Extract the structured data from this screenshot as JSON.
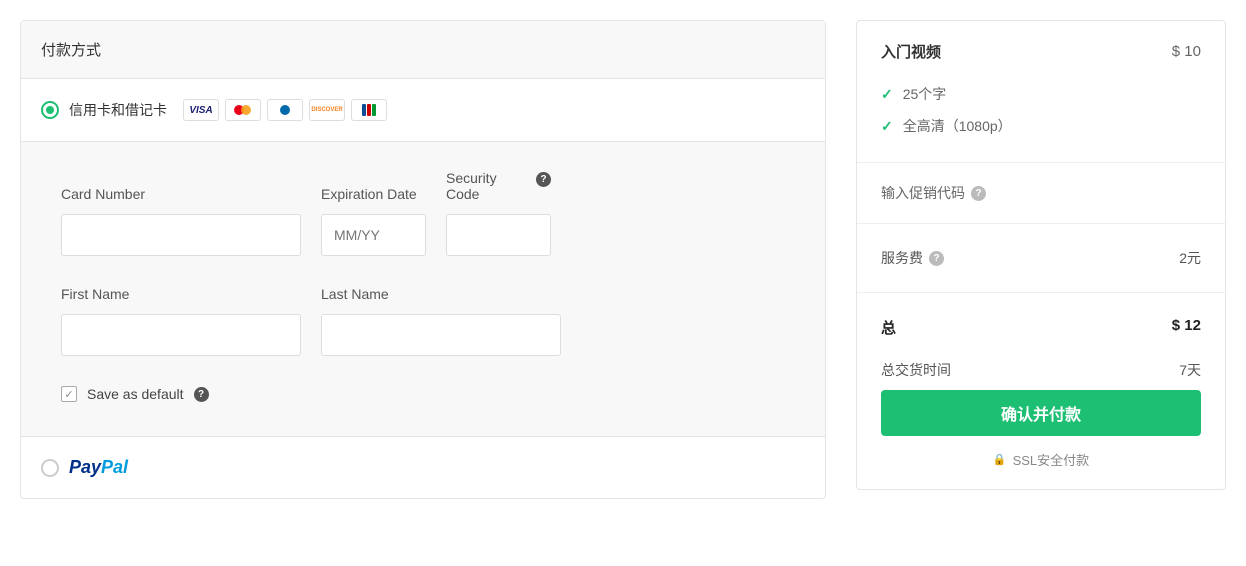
{
  "payment": {
    "header": "付款方式",
    "methods": {
      "card": {
        "label": "信用卡和借记卡",
        "selected": true,
        "logos": [
          "visa",
          "mastercard",
          "diners",
          "discover",
          "jcb"
        ]
      },
      "paypal": {
        "label": "PayPal",
        "selected": false
      }
    },
    "form": {
      "card_number_label": "Card Number",
      "expiration_label": "Expiration Date",
      "expiration_placeholder": "MM/YY",
      "cvv_label": "Security Code",
      "first_name_label": "First Name",
      "last_name_label": "Last Name",
      "save_default_label": "Save as default",
      "save_default_checked": true
    }
  },
  "summary": {
    "product_title": "入门视频",
    "product_price": "$ 10",
    "features": [
      "25个字",
      "全高清（1080p）"
    ],
    "promo_label": "输入促销代码",
    "service_fee_label": "服务费",
    "service_fee_value": "2元",
    "total_label": "总",
    "total_value": "$ 12",
    "delivery_label": "总交货时间",
    "delivery_value": "7天",
    "confirm_button": "确认并付款",
    "ssl_label": "SSL安全付款"
  }
}
